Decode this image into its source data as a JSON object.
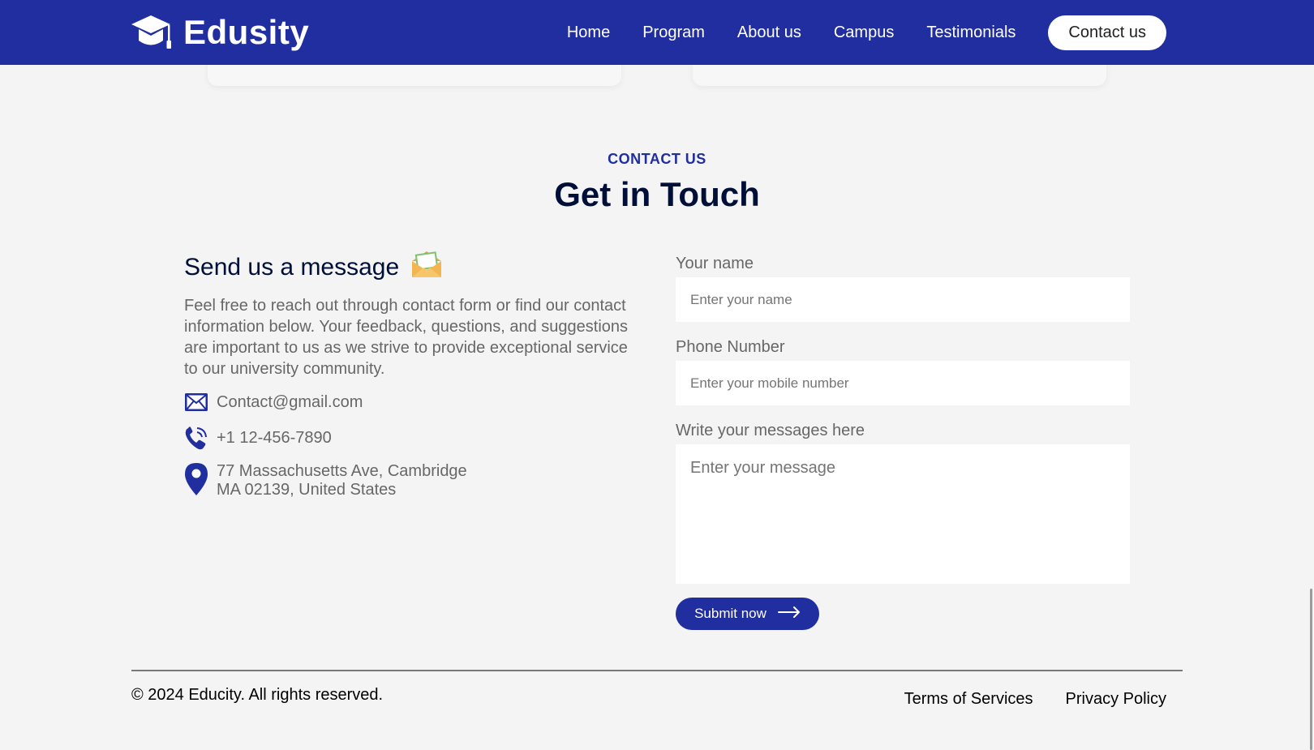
{
  "navbar": {
    "logo_text": "Edusity",
    "links": [
      "Home",
      "Program",
      "About us",
      "Campus",
      "Testimonials"
    ],
    "cta": "Contact us"
  },
  "section": {
    "subtitle": "CONTACT US",
    "title": "Get in Touch"
  },
  "contact_info": {
    "heading": "Send us a message",
    "heading_icon": "envelope-emoji-icon",
    "description": "Feel free to reach out through contact form or find our contact information below. Your feedback, questions, and suggestions are important to us as we strive to provide exceptional service to our university community.",
    "email": "Contact@gmail.com",
    "phone": "+1 12-456-7890",
    "address_line1": "77 Massachusetts Ave, Cambridge",
    "address_line2": "MA 02139, United States"
  },
  "form": {
    "name_label": "Your name",
    "name_placeholder": "Enter your name",
    "phone_label": "Phone Number",
    "phone_placeholder": "Enter your mobile number",
    "message_label": "Write your messages here",
    "message_placeholder": "Enter your message",
    "submit_label": "Submit now"
  },
  "footer": {
    "copyright": "© 2024 Educity. All rights reserved.",
    "links": [
      "Terms of Services",
      "Privacy Policy"
    ]
  },
  "colors": {
    "brand": "#212ea0",
    "heading": "#000f38",
    "text": "#676767",
    "background": "#f4f4f4"
  }
}
